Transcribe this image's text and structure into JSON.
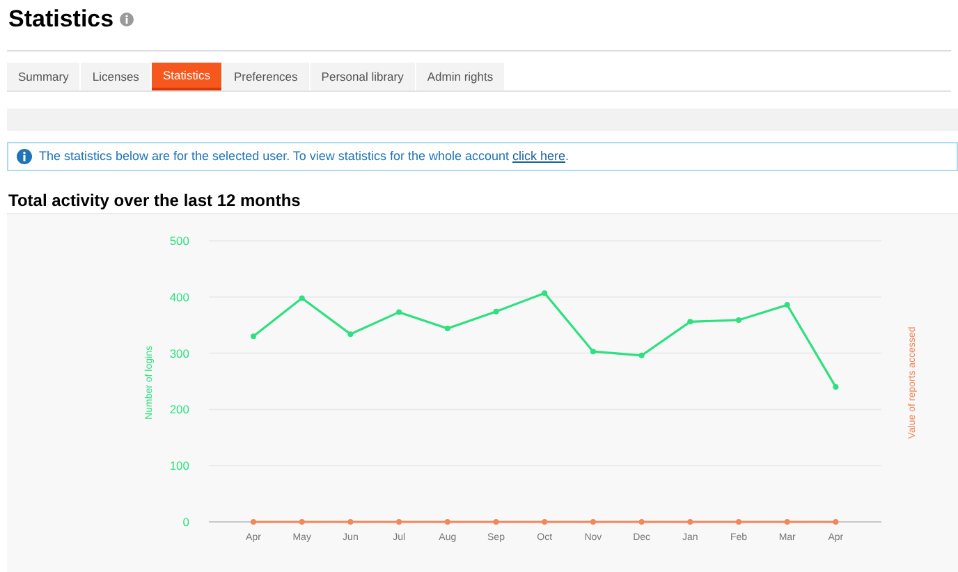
{
  "page": {
    "title": "Statistics"
  },
  "tabs": [
    {
      "label": "Summary",
      "selected": false
    },
    {
      "label": "Licenses",
      "selected": false
    },
    {
      "label": "Statistics",
      "selected": true
    },
    {
      "label": "Preferences",
      "selected": false
    },
    {
      "label": "Personal library",
      "selected": false
    },
    {
      "label": "Admin rights",
      "selected": false
    }
  ],
  "notice": {
    "text": "The statistics below are for the selected user. To view statistics for the whole account",
    "link": "click here",
    "end": "."
  },
  "section": {
    "title": "Total activity over the last 12 months",
    "chart_data": {
      "type": "line",
      "grid": true,
      "categories": [
        "Apr",
        "May",
        "Jun",
        "Jul",
        "Aug",
        "Sep",
        "Oct",
        "Nov",
        "Dec",
        "Jan",
        "Feb",
        "Mar",
        "Apr"
      ],
      "ylim": [
        0,
        500
      ],
      "yticks": [
        0,
        100,
        200,
        300,
        400,
        500
      ],
      "series": [
        {
          "name": "Number of logins",
          "color": "#2ee07f",
          "marker": true,
          "values": [
            330,
            398,
            334,
            373,
            344,
            374,
            407,
            303,
            296,
            356,
            359,
            386,
            240
          ]
        },
        {
          "name": "Value of reports accessed",
          "color": "#f0885a",
          "marker": true,
          "values": [
            0,
            0,
            0,
            0,
            0,
            0,
            0,
            0,
            0,
            0,
            0,
            0,
            0
          ]
        }
      ]
    }
  }
}
